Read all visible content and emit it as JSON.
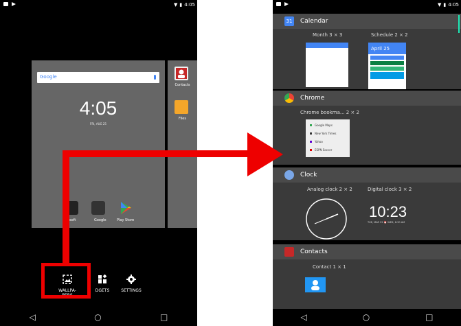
{
  "left_screen": {
    "status": {
      "time": "4:05"
    },
    "search": {
      "logo": "Google"
    },
    "clock": {
      "time": "4:05",
      "date": "FRI, AUG 25"
    },
    "side_apps": [
      {
        "label": "Contacts"
      },
      {
        "label": "Files"
      }
    ],
    "dock_apps": [
      {
        "label": "rosoft"
      },
      {
        "label": "Google"
      },
      {
        "label": "Play Store"
      }
    ],
    "bottom_options": [
      {
        "label": "WALLPA-\nPERS",
        "icon": "wallpaper-icon"
      },
      {
        "label": "DGETS",
        "icon": "widgets-icon"
      },
      {
        "label": "SETTINGS",
        "icon": "gear-icon"
      }
    ],
    "nav": {
      "back": "◁",
      "home": "○",
      "recents": "□"
    }
  },
  "right_screen": {
    "status": {
      "time": "4:05"
    },
    "sections": [
      {
        "name": "Calendar",
        "widgets": [
          "Month 3 × 3",
          "Schedule 2 × 2"
        ]
      },
      {
        "name": "Chrome",
        "widgets": [
          "Chrome bookma... 2 × 2"
        ]
      },
      {
        "name": "Clock",
        "widgets": [
          "Analog clock 2 × 2",
          "Digital clock 3 × 2"
        ]
      },
      {
        "name": "Contacts",
        "widgets": [
          "Contact 1 × 1"
        ]
      }
    ],
    "schedule_preview": {
      "date": "April 25"
    },
    "bookmarks": [
      "Google Maps",
      "New York Times",
      "Yahoo",
      "ESPN Soccer"
    ],
    "digital_clock": {
      "time": "10:23",
      "date": "TUE, MAR 22 ⏰ WED, 6:30 AM"
    },
    "nav": {
      "back": "◁",
      "home": "○",
      "recents": "□"
    }
  },
  "colors": {
    "highlight": "#ee0000",
    "calendar": "#4285f4",
    "files": "#f4a62a"
  }
}
